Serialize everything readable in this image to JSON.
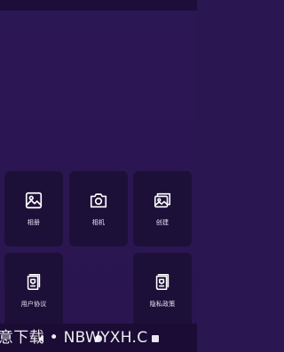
{
  "colors": {
    "background": "#2a1650",
    "tile": "#1d1038",
    "nav_bar": "#1a0c35",
    "icon": "#ffffff",
    "label": "#e9e4f5"
  },
  "tiles": [
    {
      "label": "相册",
      "icon": "image-icon"
    },
    {
      "label": "相机",
      "icon": "camera-icon"
    },
    {
      "label": "创建",
      "icon": "gallery-add-icon"
    },
    {
      "label": "用户协议",
      "icon": "document-scroll-icon"
    },
    {
      "label": "隐私政策",
      "icon": "document-scroll-icon"
    }
  ],
  "nav": {
    "back": "back-icon",
    "home": "home-icon",
    "recent": "recent-apps-icon"
  },
  "watermark": "意下载 • NBWYXH.C"
}
